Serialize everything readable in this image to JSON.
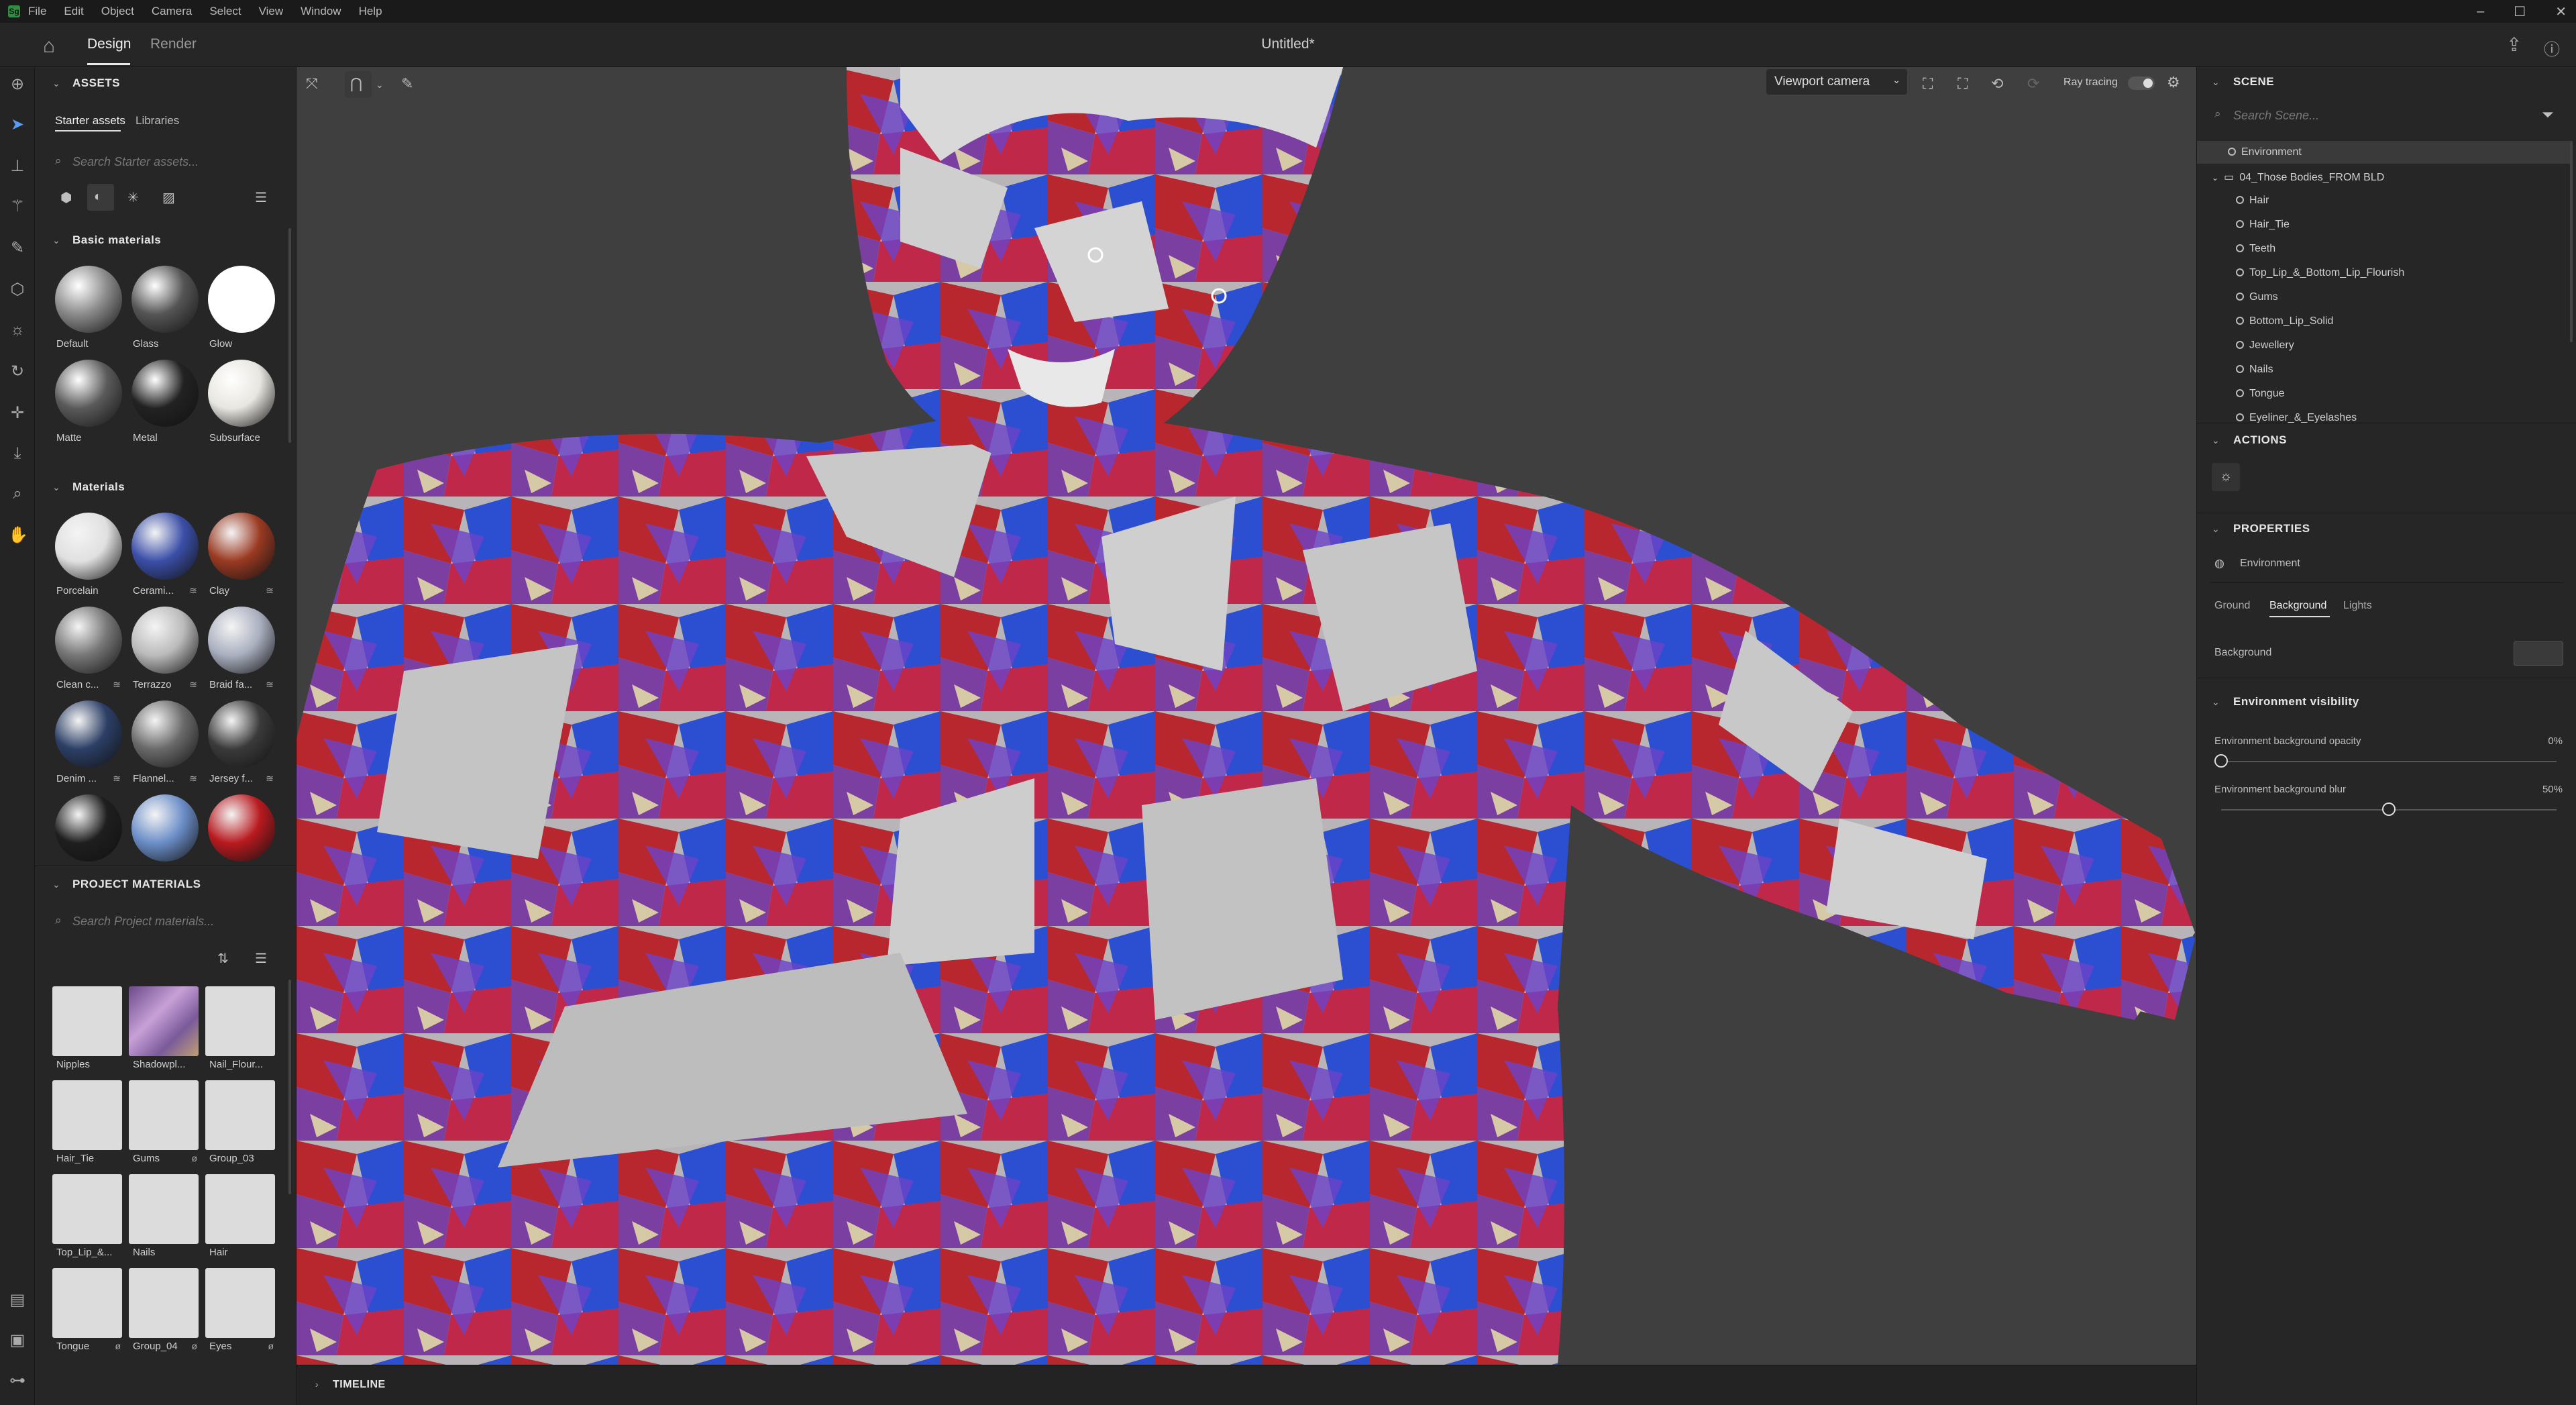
{
  "menu": [
    "File",
    "Edit",
    "Object",
    "Camera",
    "Select",
    "View",
    "Window",
    "Help"
  ],
  "app_logo": "Sg",
  "window_controls": [
    "–",
    "☐",
    "✕"
  ],
  "topbar": {
    "tabs": [
      "Design",
      "Render"
    ],
    "active_tab": "Design",
    "doc_title": "Untitled*"
  },
  "assets": {
    "header": "ASSETS",
    "tabs": [
      "Starter assets",
      "Libraries"
    ],
    "search_placeholder": "Search Starter assets...",
    "basic_header": "Basic materials",
    "basic": [
      {
        "label": "Default",
        "color": "#8a8a8a"
      },
      {
        "label": "Glass",
        "color": "#555"
      },
      {
        "label": "Glow",
        "color": "#ffffff"
      },
      {
        "label": "Matte",
        "color": "#5a5a5a"
      },
      {
        "label": "Metal",
        "color": "#222"
      },
      {
        "label": "Subsurface",
        "color": "#e8e6e0"
      }
    ],
    "materials_header": "Materials",
    "materials": [
      {
        "label": "Porcelain",
        "color": "#e0e0e0",
        "badge": ""
      },
      {
        "label": "Cerami...",
        "color": "#3b4fa8",
        "badge": "≋"
      },
      {
        "label": "Clay",
        "color": "#9a3a22",
        "badge": "≋"
      },
      {
        "label": "Clean c...",
        "color": "#777",
        "badge": "≋"
      },
      {
        "label": "Terrazzo",
        "color": "#bbb",
        "badge": "≋"
      },
      {
        "label": "Braid fa...",
        "color": "#aab0c0",
        "badge": "≋"
      },
      {
        "label": "Denim ...",
        "color": "#2c3f66",
        "badge": "≋"
      },
      {
        "label": "Flannel...",
        "color": "#6a6a6a",
        "badge": "≋"
      },
      {
        "label": "Jersey f...",
        "color": "#3a3a3a",
        "badge": "≋"
      },
      {
        "label": "",
        "color": "#1e1e1e",
        "badge": ""
      },
      {
        "label": "",
        "color": "#6b8ec8",
        "badge": ""
      },
      {
        "label": "",
        "color": "#b81a1f",
        "badge": ""
      }
    ],
    "project_header": "PROJECT MATERIALS",
    "project_search_placeholder": "Search Project materials...",
    "project": [
      {
        "label": "Nipples",
        "badge": ""
      },
      {
        "label": "Shadowpl...",
        "badge": ""
      },
      {
        "label": "Nail_Flour...",
        "badge": ""
      },
      {
        "label": "Hair_Tie",
        "badge": ""
      },
      {
        "label": "Gums",
        "badge": "ø"
      },
      {
        "label": "Group_03",
        "badge": ""
      },
      {
        "label": "Top_Lip_&...",
        "badge": ""
      },
      {
        "label": "Nails",
        "badge": ""
      },
      {
        "label": "Hair",
        "badge": ""
      },
      {
        "label": "Tongue",
        "badge": "ø"
      },
      {
        "label": "Group_04",
        "badge": "ø"
      },
      {
        "label": "Eyes",
        "badge": "ø"
      }
    ],
    "footer_icons": [
      "+",
      "⌂",
      "🗑",
      "⋯"
    ]
  },
  "viewport": {
    "camera": "Viewport camera",
    "ray_tracing_label": "Ray tracing"
  },
  "timeline": {
    "label": "TIMELINE"
  },
  "scene": {
    "header": "SCENE",
    "search_placeholder": "Search Scene...",
    "items": [
      {
        "label": "Environment",
        "indent": 0,
        "selected": true
      },
      {
        "label": "04_Those Bodies_FROM BLD",
        "indent": 0
      },
      {
        "label": "Hair",
        "indent": 1
      },
      {
        "label": "Hair_Tie",
        "indent": 1
      },
      {
        "label": "Teeth",
        "indent": 1
      },
      {
        "label": "Top_Lip_&_Bottom_Lip_Flourish",
        "indent": 1
      },
      {
        "label": "Gums",
        "indent": 1
      },
      {
        "label": "Bottom_Lip_Solid",
        "indent": 1
      },
      {
        "label": "Jewellery",
        "indent": 1
      },
      {
        "label": "Nails",
        "indent": 1
      },
      {
        "label": "Tongue",
        "indent": 1
      },
      {
        "label": "Eyeliner_&_Eyelashes",
        "indent": 1
      }
    ]
  },
  "actions": {
    "header": "ACTIONS"
  },
  "properties": {
    "header": "PROPERTIES",
    "object": "Environment",
    "tabs": [
      "Ground",
      "Background",
      "Lights"
    ],
    "active_tab": "Background",
    "background_label": "Background",
    "env_vis_header": "Environment visibility",
    "opacity_label": "Environment background opacity",
    "opacity_value": "0%",
    "opacity_fraction": 0,
    "blur_label": "Environment background blur",
    "blur_value": "50%",
    "blur_fraction": 0.5
  }
}
